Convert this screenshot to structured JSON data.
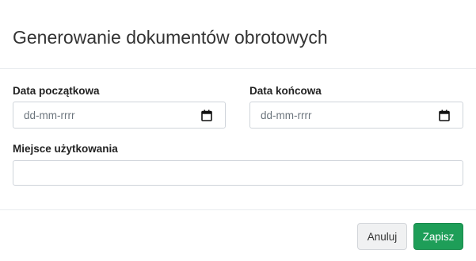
{
  "modal": {
    "title": "Generowanie dokumentów obrotowych"
  },
  "form": {
    "start_date": {
      "label": "Data początkowa",
      "placeholder": "dd-mm-rrrr",
      "value": "",
      "icon": "calendar-icon"
    },
    "end_date": {
      "label": "Data końcowa",
      "placeholder": "dd-mm-rrrr",
      "value": "",
      "icon": "calendar-icon"
    },
    "place_of_use": {
      "label": "Miejsce użytkowania",
      "value": ""
    }
  },
  "footer": {
    "cancel_label": "Anuluj",
    "save_label": "Zapisz"
  },
  "colors": {
    "save_button": "#1e9e58",
    "cancel_button": "#f0f1f2",
    "border": "#cfd4da"
  }
}
